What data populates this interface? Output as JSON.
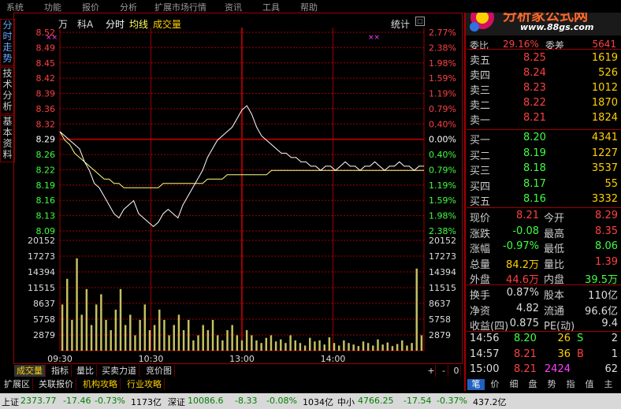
{
  "menu": [
    "系统",
    "功能",
    "报价",
    "分析",
    "扩展市场行情",
    "资讯",
    "工具",
    "帮助"
  ],
  "left_tabs": [
    "分时走势",
    "技术分析",
    "基本资料"
  ],
  "header": {
    "unit": "万",
    "code": "科A",
    "mode": "分时",
    "avg": "均线",
    "volume_label": "成交量",
    "stats": "统计",
    "markers": "××"
  },
  "price_axis": [
    "8.52",
    "8.49",
    "8.45",
    "8.42",
    "8.39",
    "8.36",
    "8.32",
    "8.29",
    "8.26",
    "8.22",
    "8.19",
    "8.16",
    "8.13",
    "8.09"
  ],
  "pct_axis": [
    "2.77%",
    "2.38%",
    "1.98%",
    "1.59%",
    "1.19%",
    "0.79%",
    "0.40%",
    "0.00%",
    "0.40%",
    "0.79%",
    "1.19%",
    "1.59%",
    "1.98%",
    "2.38%"
  ],
  "vol_axis": [
    "20152",
    "17273",
    "14394",
    "11515",
    "8637",
    "5758",
    "2879"
  ],
  "time_axis": [
    "09:30",
    "10:30",
    "13:00",
    "14:00"
  ],
  "chart_data": {
    "type": "line",
    "title": "",
    "prev_close": 8.29,
    "ylim": [
      8.06,
      8.52
    ],
    "price_line": [
      8.29,
      8.28,
      8.27,
      8.26,
      8.25,
      8.22,
      8.2,
      8.17,
      8.16,
      8.14,
      8.12,
      8.1,
      8.09,
      8.11,
      8.12,
      8.13,
      8.1,
      8.09,
      8.08,
      8.07,
      8.08,
      8.1,
      8.11,
      8.1,
      8.09,
      8.12,
      8.14,
      8.16,
      8.18,
      8.2,
      8.23,
      8.25,
      8.27,
      8.28,
      8.29,
      8.3,
      8.32,
      8.34,
      8.35,
      8.33,
      8.3,
      8.28,
      8.27,
      8.26,
      8.25,
      8.24,
      8.24,
      8.23,
      8.23,
      8.22,
      8.22,
      8.21,
      8.21,
      8.2,
      8.21,
      8.21,
      8.2,
      8.21,
      8.22,
      8.21,
      8.21,
      8.2,
      8.21,
      8.21,
      8.22,
      8.21,
      8.2,
      8.21,
      8.21,
      8.22,
      8.21,
      8.21,
      8.2,
      8.21,
      8.21
    ],
    "avg_line": [
      8.29,
      8.27,
      8.26,
      8.24,
      8.23,
      8.22,
      8.21,
      8.2,
      8.19,
      8.18,
      8.18,
      8.17,
      8.17,
      8.16,
      8.16,
      8.16,
      8.16,
      8.16,
      8.16,
      8.16,
      8.16,
      8.17,
      8.17,
      8.17,
      8.17,
      8.17,
      8.17,
      8.17,
      8.17,
      8.17,
      8.18,
      8.18,
      8.18,
      8.18,
      8.19,
      8.19,
      8.19,
      8.19,
      8.19,
      8.19,
      8.19,
      8.19,
      8.19,
      8.2,
      8.2,
      8.2,
      8.2,
      8.2,
      8.2,
      8.2,
      8.2,
      8.2,
      8.2,
      8.2,
      8.2,
      8.2,
      8.2,
      8.2,
      8.2,
      8.2,
      8.2,
      8.2,
      8.2,
      8.2,
      8.2,
      8.2,
      8.2,
      8.2,
      8.2,
      8.2,
      8.2,
      8.2,
      8.2,
      8.2,
      8.2
    ],
    "volume": [
      9000,
      14000,
      6000,
      18000,
      7000,
      12000,
      5000,
      9000,
      11000,
      6000,
      4000,
      8000,
      12000,
      5000,
      7000,
      3000,
      6000,
      9000,
      4000,
      5000,
      8000,
      6000,
      3000,
      5000,
      7000,
      4000,
      6000,
      2000,
      3000,
      5000,
      4000,
      6000,
      3000,
      2000,
      4000,
      5000,
      3000,
      2000,
      4000,
      3000,
      2000,
      1500,
      2500,
      3000,
      1800,
      2200,
      1500,
      3000,
      2000,
      1500,
      1000,
      2500,
      1800,
      2000,
      1200,
      2600,
      1500,
      1000,
      2000,
      1500,
      1200,
      900,
      1800,
      1500,
      1000,
      2200,
      1200,
      1600,
      900,
      1300,
      2000,
      1000,
      1500,
      16000,
      3000
    ],
    "vol_ylim": [
      0,
      21500
    ]
  },
  "bottom_tabs": [
    "成交量",
    "指标",
    "量比",
    "买卖力道",
    "竞价图"
  ],
  "ext_tabs": [
    "扩展区",
    "关联报价",
    "机构攻略",
    "行业攻略"
  ],
  "right_tabs": [
    "笔",
    "价",
    "细",
    "盘",
    "势",
    "指",
    "值",
    "主"
  ],
  "right_top": {
    "wei_bi_label": "委比",
    "wei_bi": "29.16%",
    "wei_cha_label": "委差",
    "wei_cha": "5641"
  },
  "asks": [
    {
      "label": "卖五",
      "price": "8.25",
      "vol": "1619"
    },
    {
      "label": "卖四",
      "price": "8.24",
      "vol": "526"
    },
    {
      "label": "卖三",
      "price": "8.23",
      "vol": "1012"
    },
    {
      "label": "卖二",
      "price": "8.22",
      "vol": "1870"
    },
    {
      "label": "卖一",
      "price": "8.21",
      "vol": "1824"
    }
  ],
  "bids": [
    {
      "label": "买一",
      "price": "8.20",
      "vol": "4341"
    },
    {
      "label": "买二",
      "price": "8.19",
      "vol": "1227"
    },
    {
      "label": "买三",
      "price": "8.18",
      "vol": "3537"
    },
    {
      "label": "买四",
      "price": "8.17",
      "vol": "55"
    },
    {
      "label": "买五",
      "price": "8.16",
      "vol": "3332"
    }
  ],
  "quote": [
    {
      "l1": "现价",
      "v1": "8.21",
      "l2": "今开",
      "v2": "8.29"
    },
    {
      "l1": "涨跌",
      "v1": "-0.08",
      "l2": "最高",
      "v2": "8.35"
    },
    {
      "l1": "涨幅",
      "v1": "-0.97%",
      "l2": "最低",
      "v2": "8.06"
    },
    {
      "l1": "总量",
      "v1": "84.2万",
      "l2": "量比",
      "v2": "1.39"
    },
    {
      "l1": "外盘",
      "v1": "44.6万",
      "l2": "内盘",
      "v2": "39.5万"
    }
  ],
  "fund": [
    {
      "l1": "换手",
      "v1": "0.87%",
      "l2": "股本",
      "v2": "110亿"
    },
    {
      "l1": "净资",
      "v1": "4.82",
      "l2": "流通",
      "v2": "96.6亿"
    },
    {
      "l1": "收益(四)",
      "v1": "0.875",
      "l2": "PE(动)",
      "v2": "9.4"
    }
  ],
  "ticks": [
    {
      "time": "14:56",
      "price": "8.20",
      "vol": "26",
      "bs": "S",
      "n": "2"
    },
    {
      "time": "14:57",
      "price": "8.21",
      "vol": "36",
      "bs": "B",
      "n": "1"
    },
    {
      "time": "15:00",
      "price": "8.21",
      "vol": "2424",
      "bs": "",
      "n": "62"
    }
  ],
  "logo": {
    "title": "分析家公式网",
    "url": "www.88gs.com"
  },
  "status": {
    "sh_label": "上证",
    "sh_val": "2373.77",
    "sh_chg": "-17.46",
    "sh_pct": "-0.73%",
    "sh_amt": "1173亿",
    "sz_label": "深证",
    "sz_val": "10086.6",
    "sz_chg": "-8.33",
    "sz_pct": "-0.08%",
    "sz_amt": "1034亿",
    "zx_label": "中小",
    "zx_val": "4766.25",
    "zx_chg": "-17.54",
    "zx_pct": "-0.37%",
    "zx_amt": "437.2亿"
  },
  "colors": {
    "up": "#ff4040",
    "down": "#40ff40",
    "grid": "#a00000",
    "price": "#ffffff",
    "avg": "#ffff80",
    "vol": "#c8c060"
  }
}
